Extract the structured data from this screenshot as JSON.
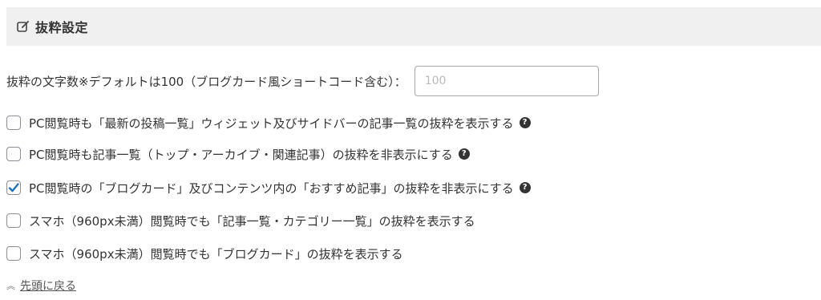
{
  "header": {
    "title": "抜粋設定",
    "icon": "edit-icon"
  },
  "excerpt_length": {
    "label": "抜粋の文字数※デフォルトは100（ブログカード風ショートコード含む）：",
    "value": "",
    "placeholder": "100"
  },
  "options": [
    {
      "label": "PC閲覧時も「最新の投稿一覧」ウィジェット及びサイドバーの記事一覧の抜粋を表示する",
      "checked": false,
      "has_help": true
    },
    {
      "label": "PC閲覧時も記事一覧（トップ・アーカイブ・関連記事）の抜粋を非表示にする",
      "checked": false,
      "has_help": true
    },
    {
      "label": "PC閲覧時の「ブログカード」及びコンテンツ内の「おすすめ記事」の抜粋を非表示にする",
      "checked": true,
      "has_help": true
    },
    {
      "label": "スマホ（960px未満）閲覧時でも「記事一覧・カテゴリー一覧」の抜粋を表示する",
      "checked": false,
      "has_help": false
    },
    {
      "label": "スマホ（960px未満）閲覧時でも「ブログカード」の抜粋を表示する",
      "checked": false,
      "has_help": false
    }
  ],
  "back_to_top": {
    "label": "先頭に戻る",
    "icon": "chevron-double-up-icon"
  },
  "colors": {
    "header_bg": "#f0f0f0",
    "check_color": "#2271b1",
    "text": "#333333"
  }
}
